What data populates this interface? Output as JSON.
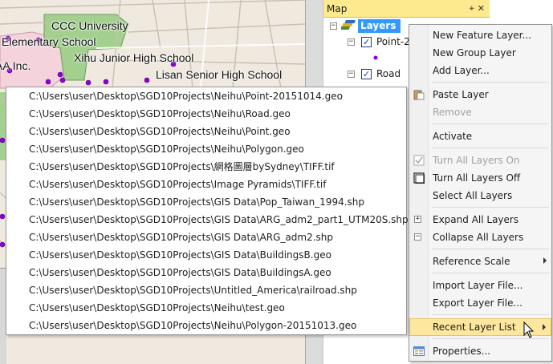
{
  "map": {
    "labels": {
      "ccc_university": "CCC University",
      "elementary_school": "Elementary School",
      "xihu_junior_high": "Xihu Junior High School",
      "lisan_senior_high": "Lisan Senior High School",
      "aa_inc": "AA Inc."
    }
  },
  "pane": {
    "title": "Map",
    "pin": "⌖",
    "close": "✕",
    "tree": {
      "root_expander": "−",
      "root_label": "Layers",
      "layer1_expander": "−",
      "layer1_label": "Point-2",
      "layer2_expander": "−",
      "layer2_label": "Road",
      "check_glyph": "✓"
    }
  },
  "recent_files": [
    "C:\\Users\\user\\Desktop\\SGD10Projects\\Neihu\\Point-20151014.geo",
    "C:\\Users\\user\\Desktop\\SGD10Projects\\Neihu\\Road.geo",
    "C:\\Users\\user\\Desktop\\SGD10Projects\\Neihu\\Point.geo",
    "C:\\Users\\user\\Desktop\\SGD10Projects\\Neihu\\Polygon.geo",
    "C:\\Users\\user\\Desktop\\SGD10Projects\\網格圖層bySydney\\TIFF.tif",
    "C:\\Users\\user\\Desktop\\SGD10Projects\\Image Pyramids\\TIFF.tif",
    "C:\\Users\\user\\Desktop\\SGD10Projects\\GIS Data\\Pop_Taiwan_1994.shp",
    "C:\\Users\\user\\Desktop\\SGD10Projects\\GIS Data\\ARG_adm2_part1_UTM20S.shp",
    "C:\\Users\\user\\Desktop\\SGD10Projects\\GIS Data\\ARG_adm2.shp",
    "C:\\Users\\user\\Desktop\\SGD10Projects\\GIS Data\\BuildingsB.geo",
    "C:\\Users\\user\\Desktop\\SGD10Projects\\GIS Data\\BuildingsA.geo",
    "C:\\Users\\user\\Desktop\\SGD10Projects\\Untitled_America\\railroad.shp",
    "C:\\Users\\user\\Desktop\\SGD10Projects\\Neihu\\test.geo",
    "C:\\Users\\user\\Desktop\\SGD10Projects\\Neihu\\Polygon-20151013.geo"
  ],
  "context_menu": {
    "new_feature_layer": "New Feature Layer...",
    "new_group_layer": "New Group Layer",
    "add_layer": "Add Layer...",
    "paste_layer": "Paste Layer",
    "remove": "Remove",
    "activate": "Activate",
    "turn_all_layers_on": "Turn All Layers On",
    "turn_all_layers_off": "Turn All Layers Off",
    "select_all_layers": "Select All Layers",
    "expand_all_layers": "Expand All Layers",
    "collapse_all_layers": "Collapse All Layers",
    "reference_scale": "Reference Scale",
    "import_layer_file": "Import Layer File...",
    "export_layer_file": "Export Layer File...",
    "recent_layer_list": "Recent Layer List",
    "properties": "Properties...",
    "expand_glyph": "+",
    "collapse_glyph": "−",
    "icons": [
      "paste-icon",
      "checkbox-checked-icon",
      "checkbox-empty-icon",
      "expand-icon",
      "collapse-icon",
      "properties-icon"
    ]
  },
  "colors": {
    "pane_title_bg": "#fde98e",
    "selection_blue": "#3399ff",
    "menu_highlight": "#fde79e",
    "map_point": "#8e00d6",
    "green_area": "#a3d08e",
    "pink_area": "#f5d3dd"
  }
}
